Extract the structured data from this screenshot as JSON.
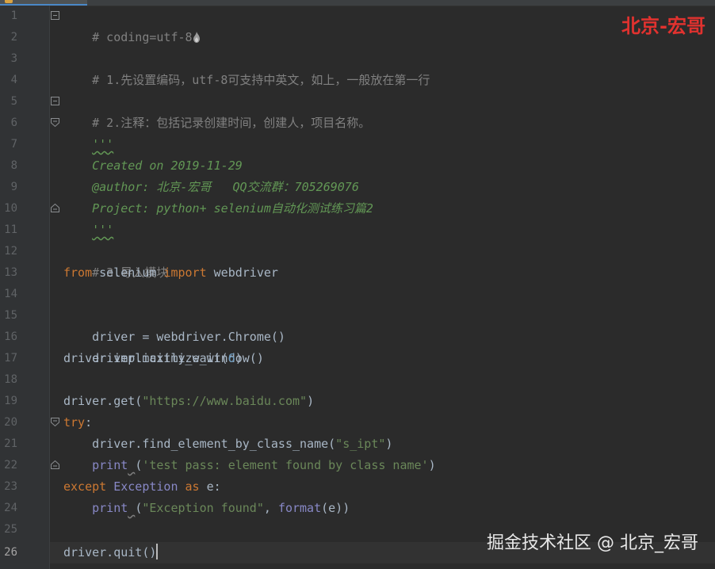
{
  "watermarks": {
    "top": "北京-宏哥",
    "bottom": "掘金技术社区 @ 北京_宏哥"
  },
  "editor": {
    "current_line": "26",
    "line_numbers": [
      "1",
      "2",
      "3",
      "4",
      "5",
      "6",
      "7",
      "8",
      "9",
      "10",
      "11",
      "12",
      "13",
      "14",
      "15",
      "16",
      "17",
      "18",
      "19",
      "20",
      "21",
      "22",
      "23",
      "24",
      "25",
      "26"
    ],
    "lines": {
      "l1": {
        "text": "# coding=utf-8"
      },
      "l3": {
        "text": "# 1.先设置编码，utf-8可支持中英文，如上，一般放在第一行"
      },
      "l5": {
        "text": "# 2.注释：包括记录创建时间，创建人，项目名称。"
      },
      "l6": {
        "text": "'''"
      },
      "l7": {
        "text": "Created on 2019-11-29"
      },
      "l8": {
        "text": "@author: 北京-宏哥   QQ交流群：705269076"
      },
      "l9": {
        "text": "Project: python+ selenium自动化测试练习篇2"
      },
      "l10": {
        "text": "'''"
      },
      "l12": {
        "text": "# 3.导入模块"
      },
      "l13": {
        "kw1": "from",
        "mod": " selenium ",
        "kw2": "import",
        "name": " webdriver"
      },
      "l15": {
        "text": "driver = webdriver.Chrome()"
      },
      "l16": {
        "text": "driver.maximize_window()"
      },
      "l17": {
        "pre": "driver.implicitly_wait(",
        "num": "6",
        "post": ")"
      },
      "l19": {
        "pre": "driver.get(",
        "str": "\"https://www.baidu.com\"",
        "post": ")"
      },
      "l20": {
        "kw": "try",
        "post": ":"
      },
      "l21": {
        "pre": "    driver.find_element_by_class_name(",
        "str": "\"s_ipt\"",
        "post": ")"
      },
      "l22": {
        "indent": "    ",
        "fn": "print",
        "wavy": " ",
        "pre": "(",
        "str": "'test pass: element found by class name'",
        "post": ")"
      },
      "l23": {
        "kw1": "except",
        "sp1": " ",
        "cls": "Exception",
        "sp2": " ",
        "kw2": "as",
        "post": " e:"
      },
      "l24": {
        "indent": "    ",
        "fn": "print",
        "wavy": " ",
        "pre": "(",
        "str": "\"Exception found\"",
        "comma": ", ",
        "fn2": "format",
        "post": "(e))"
      },
      "l26": {
        "text": "driver.quit()"
      }
    }
  },
  "colors": {
    "background": "#2b2b2b",
    "gutter": "#313335",
    "comment": "#808080",
    "docstring": "#629755",
    "keyword": "#cc7832",
    "string": "#6a8759",
    "number": "#6897bb",
    "builtin": "#8888c6",
    "plain": "#a9b7c6",
    "watermark_red": "#e1322f"
  },
  "icons": {
    "top_decoration": "flame-icon",
    "fold": "fold-marker-icon"
  }
}
